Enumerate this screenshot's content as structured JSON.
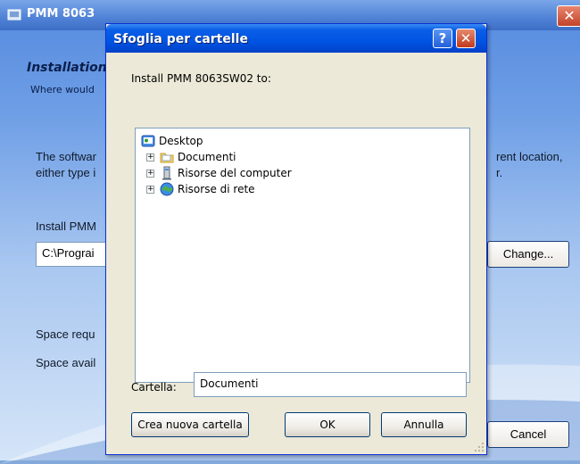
{
  "background": {
    "title": "PMM 8063",
    "heading": "Installation",
    "subheading": "Where would",
    "text_line1": "The softwar",
    "text_line2": "either type i",
    "text_right1": "rent location,",
    "text_right2": "r.",
    "install_label": "Install PMM",
    "path_value": "C:\\Prograi",
    "change_button": "Change...",
    "space_required": "Space requ",
    "space_available": "Space avail",
    "cancel_button": "Cancel"
  },
  "dialog": {
    "title": "Sfoglia per cartelle",
    "help_glyph": "?",
    "close_glyph": "✕",
    "prompt": "Install PMM 8063SW02 to:",
    "tree": [
      {
        "label": "Desktop",
        "icon": "desktop-icon",
        "level": 0,
        "expander": ""
      },
      {
        "label": "Documenti",
        "icon": "folder-icon",
        "level": 1,
        "expander": "+"
      },
      {
        "label": "Risorse del computer",
        "icon": "computer-icon",
        "level": 1,
        "expander": "+"
      },
      {
        "label": "Risorse di rete",
        "icon": "network-icon",
        "level": 1,
        "expander": "+"
      }
    ],
    "folder_label": "Cartella:",
    "folder_value": "Documenti",
    "new_folder_button": "Crea nuova cartella",
    "ok_button": "OK",
    "cancel_button": "Annulla"
  }
}
